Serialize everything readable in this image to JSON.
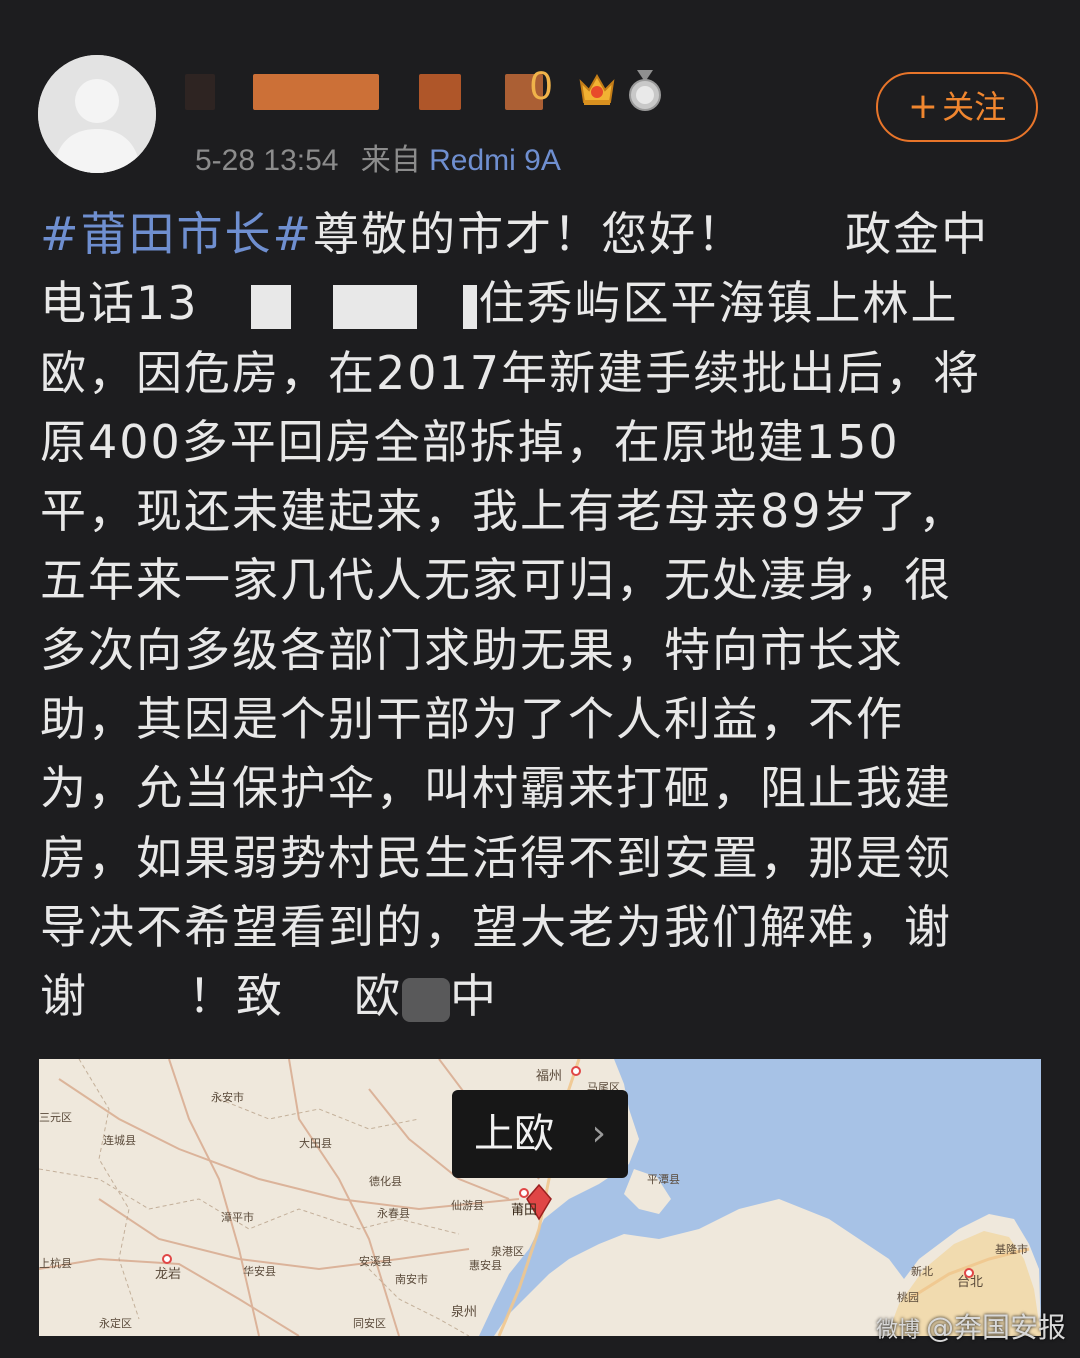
{
  "header": {
    "username_visible_tail": "0",
    "timestamp": "5-28 13:54",
    "source_label": "来自",
    "device": "Redmi 9A",
    "follow_label": "关注",
    "follow_plus": "+"
  },
  "post": {
    "lines": [
      {
        "hashtag": "#莆田市长#",
        "text": "尊敬的市才！您好！",
        "tail": "政金中"
      },
      {
        "pre": "电话13",
        "post": "住秀屿区平海镇上林上"
      },
      {
        "text": "欧，因危房，在2017年新建手续批出后，将"
      },
      {
        "text": "原400多平回房全部拆掉，在原地建150"
      },
      {
        "text": "平，现还未建起来，我上有老母亲89岁了，"
      },
      {
        "text": "五年来一家几代人无家可归，无处凄身，很"
      },
      {
        "text": "多次向多级各部门求助无果，特向市长求"
      },
      {
        "text": "助，其因是个别干部为了个人利益，不作"
      },
      {
        "text": "为，允当保护伞，叫村霸来打砸，阻止我建"
      },
      {
        "text": "房，如果弱势村民生活得不到安置，那是领"
      },
      {
        "text": "导决不希望看到的，望大老为我们解难，谢"
      },
      {
        "a": "谢",
        "b": "！致",
        "c": "欧",
        "d": "中"
      }
    ]
  },
  "map": {
    "popup_label": "上欧",
    "popup_chevron": "›",
    "labels": [
      {
        "text": "福州"
      },
      {
        "text": "马尾区"
      },
      {
        "text": "永安市"
      },
      {
        "text": "三元区"
      },
      {
        "text": "连城县"
      },
      {
        "text": "大田县"
      },
      {
        "text": "德化县"
      },
      {
        "text": "永春县"
      },
      {
        "text": "仙游县"
      },
      {
        "text": "莆田"
      },
      {
        "text": "平潭县"
      },
      {
        "text": "漳平市"
      },
      {
        "text": "龙岩"
      },
      {
        "text": "华安县"
      },
      {
        "text": "安溪县"
      },
      {
        "text": "南安市"
      },
      {
        "text": "泉港区"
      },
      {
        "text": "惠安县"
      },
      {
        "text": "泉州"
      },
      {
        "text": "上杭县"
      },
      {
        "text": "永定区"
      },
      {
        "text": "同安区"
      },
      {
        "text": "新北"
      },
      {
        "text": "台北"
      },
      {
        "text": "基隆市"
      },
      {
        "text": "桃园"
      }
    ]
  },
  "watermark": {
    "prefix": "微博",
    "text": "@奔国安报"
  },
  "colors": {
    "background": "#1d1d1f",
    "hashtag": "#6f8fd0",
    "follow": "#e8752a",
    "sea": "#a7c2e6",
    "land": "#efe8dc"
  }
}
